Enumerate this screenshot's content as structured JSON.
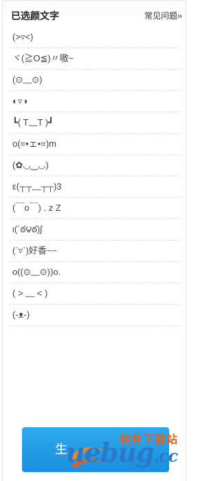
{
  "header": {
    "title": "已选颜文字",
    "faq_label": "常见问题",
    "faq_chevrons": "››"
  },
  "emoticons": [
    "(>▿<)",
    "ヾ(≧O≦)〃嗷~",
    "(⊙﹏⊙)",
    "◐▿◑",
    "┗( T﹏T )┛",
    "o(=•ェ•=)m",
    "(✿◡‿◡)",
    "ε(┬┬﹏┬┬)3",
    "(￣o￣) . z Z",
    "ι(´ఠ౪ఠ)ʃ",
    "(ˊ▿ˋ)好香~~",
    "o((⊙﹏⊙))o.",
    "( > ﹏ < )",
    "(-ᴥ-)"
  ],
  "generate_button": {
    "label": "生",
    "color": "#1e96e2"
  },
  "watermark": {
    "site_name": "软件下载站",
    "logo_text": "uebug",
    "logo_suffix": ".cc"
  },
  "colors": {
    "accent": "#1e96e2",
    "watermark_orange": "#e85f1d",
    "watermark_blue": "#2b77c8"
  }
}
